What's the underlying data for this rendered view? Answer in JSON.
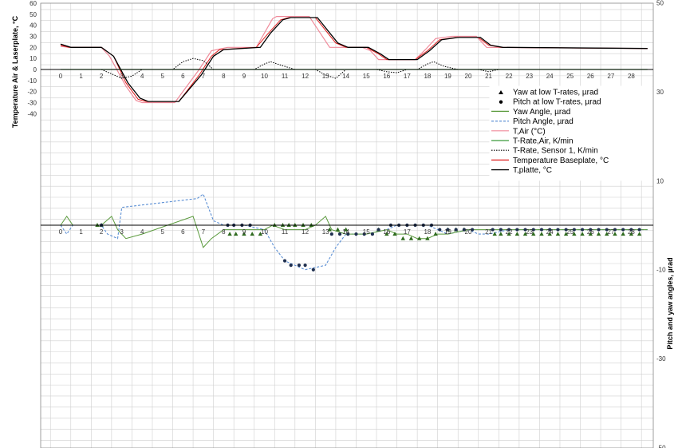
{
  "chart_data": {
    "type": "line",
    "left_axis": {
      "label": "Temperature Air & Laserplate, °C",
      "ticks": [
        60,
        50,
        40,
        30,
        20,
        10,
        0,
        -10,
        -20,
        -30,
        -40
      ]
    },
    "right_axis": {
      "label": "Pitch and yaw angles, µrad",
      "ticks": [
        50,
        30,
        10,
        -10,
        -30,
        -50
      ],
      "ylim": [
        -50,
        50
      ]
    },
    "x_ticks_top": [
      "0",
      "1",
      "2",
      "3",
      "4",
      "5",
      "6",
      "7",
      "8",
      "9",
      "10",
      "11",
      "12",
      "13",
      "14",
      "15",
      "16",
      "17",
      "18",
      "19",
      "20",
      "21",
      "22",
      "23",
      "24",
      "25",
      "26",
      "27",
      "28"
    ],
    "x_ticks_bottom": [
      "0",
      "1",
      "2",
      "3",
      "4",
      "5",
      "6",
      "7",
      "8",
      "9",
      "10",
      "11",
      "12",
      "13",
      "14",
      "15",
      "16",
      "17",
      "18",
      "19",
      "20",
      "21",
      "22",
      "23",
      "24",
      "25",
      "26",
      "27",
      "28"
    ],
    "xlim": [
      -0.5,
      28.8
    ],
    "grid": true,
    "legend": {
      "placement": "right",
      "entries": [
        {
          "label": "Yaw at low T-rates, µrad",
          "color": "#000000",
          "marker": "triangle"
        },
        {
          "label": "Pitch at low T-rates, µrad",
          "color": "#000000",
          "marker": "circle"
        },
        {
          "label": "Yaw Angle, µrad",
          "color": "#5a9a3c",
          "style": "solid"
        },
        {
          "label": "Pitch Angle, µrad",
          "color": "#5b8fd4",
          "style": "dashed"
        },
        {
          "label": "T,Air (°C)",
          "color": "#f08a9a",
          "style": "solid"
        },
        {
          "label": "T-Rate,Air, K/min",
          "color": "#3a9a3a",
          "style": "solid"
        },
        {
          "label": "T-Rate, Sensor 1, K/min",
          "color": "#000000",
          "style": "dotted"
        },
        {
          "label": "Temperature Baseplate, °C",
          "color": "#e02020",
          "style": "solid"
        },
        {
          "label": "T,platte, °C",
          "color": "#000000",
          "style": "solid"
        }
      ]
    },
    "series_left": [
      {
        "name": "T,Air (°C)",
        "color": "#f08a9a",
        "width": 1.2,
        "points": [
          [
            0,
            21
          ],
          [
            0.4,
            20
          ],
          [
            2,
            20
          ],
          [
            2.4,
            12
          ],
          [
            3.2,
            -15
          ],
          [
            3.7,
            -28
          ],
          [
            4,
            -30
          ],
          [
            5.6,
            -30
          ],
          [
            6.8,
            0
          ],
          [
            7.4,
            17
          ],
          [
            8.2,
            20
          ],
          [
            9.6,
            20
          ],
          [
            10.4,
            46
          ],
          [
            10.6,
            48
          ],
          [
            12.2,
            48
          ],
          [
            13.2,
            20
          ],
          [
            14.8,
            20
          ],
          [
            15.2,
            17
          ],
          [
            15.6,
            9
          ],
          [
            17.4,
            9
          ],
          [
            17.9,
            18
          ],
          [
            18.4,
            28
          ],
          [
            19.2,
            30
          ],
          [
            20.4,
            30
          ],
          [
            20.9,
            20
          ],
          [
            28.8,
            19
          ]
        ]
      },
      {
        "name": "Temperature Baseplate, °C",
        "color": "#e02020",
        "width": 1.0,
        "points": [
          [
            0,
            22
          ],
          [
            0.4,
            20
          ],
          [
            2,
            20
          ],
          [
            2.6,
            12
          ],
          [
            3.2,
            -12
          ],
          [
            3.8,
            -27
          ],
          [
            4.2,
            -29
          ],
          [
            5.8,
            -29
          ],
          [
            6.8,
            -5
          ],
          [
            7.4,
            12
          ],
          [
            7.8,
            18
          ],
          [
            9.6,
            20
          ],
          [
            10.2,
            33
          ],
          [
            10.8,
            45
          ],
          [
            11.2,
            47
          ],
          [
            12.5,
            47
          ],
          [
            13.5,
            24
          ],
          [
            14,
            20
          ],
          [
            15,
            20
          ],
          [
            15.6,
            14
          ],
          [
            16,
            9
          ],
          [
            17.4,
            9
          ],
          [
            18,
            17
          ],
          [
            18.6,
            27
          ],
          [
            19.4,
            29
          ],
          [
            20.5,
            29
          ],
          [
            21,
            22
          ],
          [
            21.6,
            20
          ],
          [
            28.8,
            19
          ]
        ]
      },
      {
        "name": "T,platte, °C",
        "color": "#000000",
        "width": 1.3,
        "points": [
          [
            0,
            23
          ],
          [
            0.5,
            20
          ],
          [
            2,
            20
          ],
          [
            2.6,
            12
          ],
          [
            3.3,
            -12
          ],
          [
            3.9,
            -26
          ],
          [
            4.3,
            -29
          ],
          [
            5.8,
            -29
          ],
          [
            6.9,
            -5
          ],
          [
            7.5,
            12
          ],
          [
            8,
            18
          ],
          [
            9.8,
            20
          ],
          [
            10.3,
            33
          ],
          [
            10.9,
            45
          ],
          [
            11.3,
            47
          ],
          [
            12.6,
            47
          ],
          [
            13.6,
            24
          ],
          [
            14.1,
            20
          ],
          [
            15.1,
            20
          ],
          [
            15.7,
            14
          ],
          [
            16.1,
            9
          ],
          [
            17.5,
            9
          ],
          [
            18.1,
            17
          ],
          [
            18.7,
            27
          ],
          [
            19.5,
            29
          ],
          [
            20.6,
            29
          ],
          [
            21.1,
            22
          ],
          [
            21.7,
            20
          ],
          [
            28.8,
            19
          ]
        ]
      },
      {
        "name": "T-Rate, Sensor 1, K/min",
        "color": "#000000",
        "width": 1.0,
        "dash": "1.5,1.5",
        "points": [
          [
            0,
            0
          ],
          [
            2,
            0
          ],
          [
            2.5,
            -4
          ],
          [
            3,
            -8
          ],
          [
            3.5,
            -6
          ],
          [
            4,
            0
          ],
          [
            5.5,
            0
          ],
          [
            6,
            7
          ],
          [
            6.5,
            10
          ],
          [
            7,
            8
          ],
          [
            7.5,
            0
          ],
          [
            9.5,
            0
          ],
          [
            10,
            5
          ],
          [
            10.3,
            7
          ],
          [
            10.8,
            4
          ],
          [
            11.5,
            0
          ],
          [
            12.5,
            0
          ],
          [
            13,
            -5
          ],
          [
            13.5,
            -8
          ],
          [
            14,
            0
          ],
          [
            15.5,
            0
          ],
          [
            16,
            -2
          ],
          [
            16.5,
            -3
          ],
          [
            17,
            0
          ],
          [
            17.5,
            0
          ],
          [
            18,
            5
          ],
          [
            18.3,
            7
          ],
          [
            18.8,
            3
          ],
          [
            19.5,
            0
          ],
          [
            20.5,
            0
          ],
          [
            21,
            -2
          ],
          [
            21.5,
            0
          ],
          [
            28.8,
            0
          ]
        ]
      },
      {
        "name": "T-Rate,Air, K/min",
        "color": "#3a9a3a",
        "width": 1.3,
        "points": [
          [
            0,
            0
          ],
          [
            28.8,
            0
          ]
        ]
      }
    ],
    "series_right": [
      {
        "name": "Pitch Angle, µrad",
        "color": "#5b8fd4",
        "width": 1.1,
        "dash": "3,2",
        "points": [
          [
            0,
            0
          ],
          [
            0.3,
            -2
          ],
          [
            0.6,
            0
          ],
          [
            1,
            0
          ],
          [
            2,
            0
          ],
          [
            2.3,
            -2
          ],
          [
            2.8,
            -3
          ],
          [
            3,
            4
          ],
          [
            6.7,
            6
          ],
          [
            7,
            7
          ],
          [
            7.5,
            1
          ],
          [
            8,
            0
          ],
          [
            9,
            0
          ],
          [
            10,
            -1
          ],
          [
            10.5,
            -5
          ],
          [
            11,
            -8
          ],
          [
            11.5,
            -9
          ],
          [
            12,
            -10
          ],
          [
            12.5,
            -9.5
          ],
          [
            13,
            -9
          ],
          [
            13.5,
            -5
          ],
          [
            14,
            -2
          ],
          [
            15,
            -2
          ],
          [
            16,
            -1
          ],
          [
            16.5,
            0
          ],
          [
            17,
            0
          ],
          [
            18,
            0
          ],
          [
            18.5,
            -1
          ],
          [
            19,
            -2
          ],
          [
            20,
            -1
          ],
          [
            20.5,
            -2
          ],
          [
            21,
            -2
          ],
          [
            22,
            -1
          ],
          [
            28.8,
            -1
          ]
        ]
      },
      {
        "name": "Yaw Angle, µrad",
        "color": "#5a9a3c",
        "width": 1.0,
        "points": [
          [
            0,
            0
          ],
          [
            0.3,
            2
          ],
          [
            0.6,
            0
          ],
          [
            1,
            0
          ],
          [
            2,
            0
          ],
          [
            2.5,
            2
          ],
          [
            2.8,
            -1
          ],
          [
            3.2,
            -3
          ],
          [
            4,
            -2
          ],
          [
            6.5,
            2
          ],
          [
            7,
            -5
          ],
          [
            7.4,
            -3
          ],
          [
            8,
            -1
          ],
          [
            9,
            -1
          ],
          [
            10,
            -1
          ],
          [
            10.4,
            0
          ],
          [
            11,
            -1
          ],
          [
            12,
            -1
          ],
          [
            12.5,
            0
          ],
          [
            13,
            2
          ],
          [
            13.3,
            -1
          ],
          [
            14,
            -2
          ],
          [
            15,
            -2
          ],
          [
            16,
            -1
          ],
          [
            16.5,
            -2
          ],
          [
            17,
            -2
          ],
          [
            17.5,
            -3
          ],
          [
            18,
            -3
          ],
          [
            18.5,
            -2
          ],
          [
            19,
            -2
          ],
          [
            20,
            -1
          ],
          [
            20.5,
            -1
          ],
          [
            21,
            -1
          ],
          [
            28.8,
            -1
          ]
        ]
      }
    ],
    "markers_right": [
      {
        "name": "Yaw at low T-rates, µrad",
        "marker": "triangle",
        "color": "#2f6b1f",
        "points": [
          [
            1.8,
            0
          ],
          [
            2,
            0
          ],
          [
            8.3,
            -2
          ],
          [
            8.6,
            -2
          ],
          [
            9,
            -2
          ],
          [
            9.4,
            -2
          ],
          [
            9.8,
            -2
          ],
          [
            10.5,
            0
          ],
          [
            10.9,
            0
          ],
          [
            11.2,
            0
          ],
          [
            11.5,
            0
          ],
          [
            11.9,
            0
          ],
          [
            12.3,
            0
          ],
          [
            13.2,
            -1
          ],
          [
            13.6,
            -1
          ],
          [
            14,
            -1
          ],
          [
            15.6,
            -1
          ],
          [
            16,
            -2
          ],
          [
            16.4,
            -2
          ],
          [
            16.8,
            -3
          ],
          [
            17.2,
            -3
          ],
          [
            17.6,
            -3
          ],
          [
            18,
            -3
          ],
          [
            18.4,
            -2
          ],
          [
            19,
            -1
          ],
          [
            19.4,
            -1
          ],
          [
            19.8,
            -1
          ],
          [
            21.3,
            -2
          ],
          [
            21.6,
            -2
          ],
          [
            22,
            -2
          ],
          [
            22.4,
            -2
          ],
          [
            22.8,
            -2
          ],
          [
            23.2,
            -2
          ],
          [
            23.6,
            -2
          ],
          [
            24,
            -2
          ],
          [
            24.4,
            -2
          ],
          [
            24.8,
            -2
          ],
          [
            25.2,
            -2
          ],
          [
            25.6,
            -2
          ],
          [
            26,
            -2
          ],
          [
            26.4,
            -2
          ],
          [
            26.8,
            -2
          ],
          [
            27.2,
            -2
          ],
          [
            27.6,
            -2
          ],
          [
            28,
            -2
          ],
          [
            28.4,
            -2
          ]
        ]
      },
      {
        "name": "Pitch at low T-rates, µrad",
        "marker": "circle",
        "color": "#1f2f4f",
        "points": [
          [
            2,
            0
          ],
          [
            8.2,
            0
          ],
          [
            8.5,
            0
          ],
          [
            8.9,
            0
          ],
          [
            9.3,
            0
          ],
          [
            11,
            -8
          ],
          [
            11.3,
            -9
          ],
          [
            11.7,
            -9
          ],
          [
            12,
            -9
          ],
          [
            12.4,
            -10
          ],
          [
            13.3,
            -2
          ],
          [
            13.7,
            -2
          ],
          [
            14.1,
            -2
          ],
          [
            14.5,
            -2
          ],
          [
            14.9,
            -2
          ],
          [
            15.3,
            -2
          ],
          [
            15.6,
            -1
          ],
          [
            16.2,
            0
          ],
          [
            16.6,
            0
          ],
          [
            17,
            0
          ],
          [
            17.4,
            0
          ],
          [
            17.8,
            0
          ],
          [
            18.2,
            0
          ],
          [
            18.6,
            -1
          ],
          [
            19,
            -1
          ],
          [
            19.4,
            -1
          ],
          [
            19.8,
            -1
          ],
          [
            20.2,
            -1
          ],
          [
            21.2,
            -1
          ],
          [
            21.6,
            -1
          ],
          [
            22,
            -1
          ],
          [
            22.4,
            -1
          ],
          [
            22.8,
            -1
          ],
          [
            23.2,
            -1
          ],
          [
            23.6,
            -1
          ],
          [
            24,
            -1
          ],
          [
            24.4,
            -1
          ],
          [
            24.8,
            -1
          ],
          [
            25.2,
            -1
          ],
          [
            25.6,
            -1
          ],
          [
            26,
            -1
          ],
          [
            26.4,
            -1
          ],
          [
            26.8,
            -1
          ],
          [
            27.2,
            -1
          ],
          [
            27.6,
            -1
          ],
          [
            28,
            -1
          ],
          [
            28.4,
            -1
          ]
        ]
      }
    ]
  }
}
